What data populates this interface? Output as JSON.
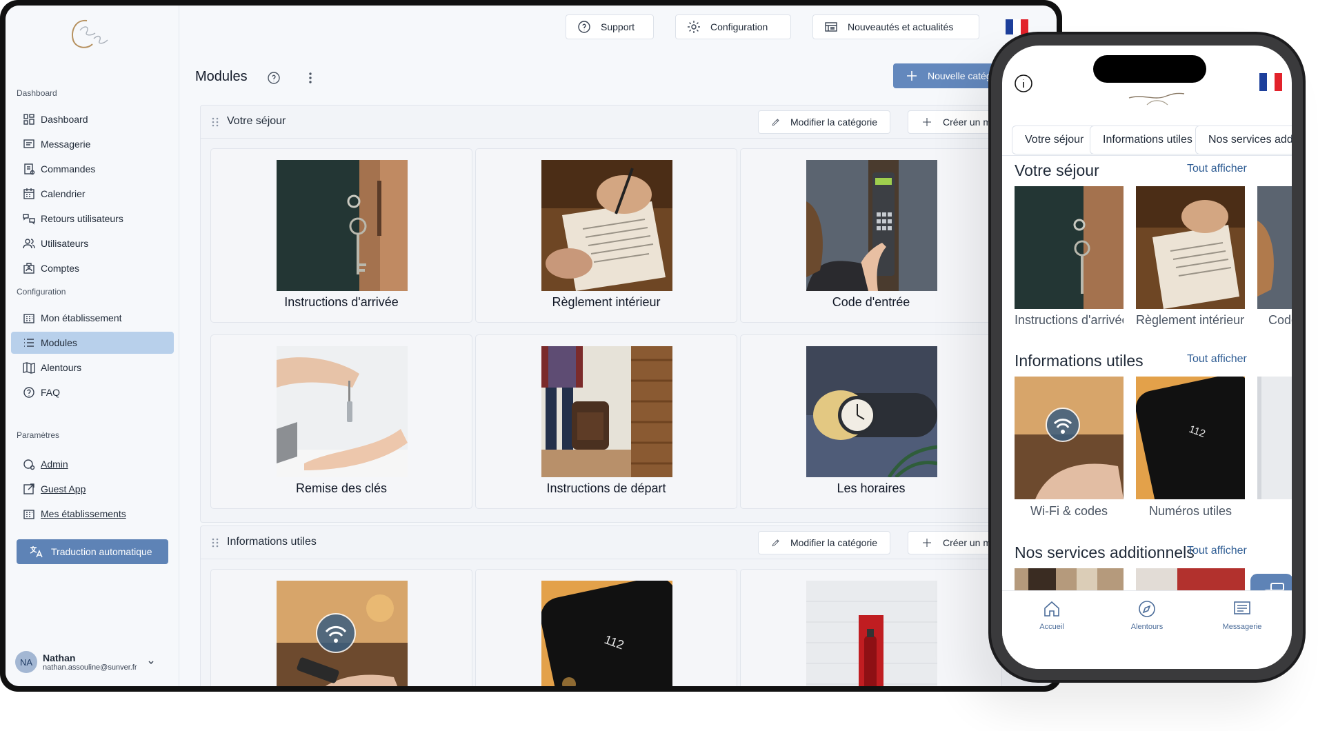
{
  "sidebar": {
    "sections": {
      "dashboard": "Dashboard",
      "configuration": "Configuration",
      "parametres": "Paramètres"
    },
    "items": {
      "dashboard": "Dashboard",
      "messagerie": "Messagerie",
      "commandes": "Commandes",
      "calendrier": "Calendrier",
      "retours": "Retours utilisateurs",
      "utilisateurs": "Utilisateurs",
      "comptes": "Comptes",
      "etablissement": "Mon établissement",
      "modules": "Modules",
      "alentours": "Alentours",
      "faq": "FAQ",
      "admin": "Admin",
      "guest_app": "Guest App",
      "mes_etablissements": "Mes établissements"
    },
    "translate_button": "Traduction automatique",
    "user": {
      "initials": "NA",
      "name": "Nathan",
      "email": "nathan.assouline@sunver.fr"
    }
  },
  "topbar": {
    "support": "Support",
    "configuration": "Configuration",
    "news": "Nouveautés et actualités"
  },
  "page": {
    "title": "Modules",
    "new_category_button": "Nouvelle catégorie"
  },
  "categories": [
    {
      "name": "Votre séjour",
      "edit_label": "Modifier la catégorie",
      "create_label": "Créer un module",
      "modules": [
        "Instructions d'arrivée",
        "Règlement intérieur",
        "Code d'entrée",
        "Remise des clés",
        "Instructions de départ",
        "Les horaires"
      ]
    },
    {
      "name": "Informations utiles",
      "edit_label": "Modifier la catégorie",
      "create_label": "Créer un module"
    }
  ],
  "phone": {
    "chips": [
      "Votre séjour",
      "Informations utiles",
      "Nos services additionnels"
    ],
    "sections": [
      {
        "title": "Votre séjour",
        "see_all": "Tout afficher",
        "tiles": [
          "Instructions d'arrivée",
          "Règlement intérieur",
          "Code d'entrée"
        ]
      },
      {
        "title": "Informations utiles",
        "see_all": "Tout afficher",
        "tiles": [
          "Wi-Fi & codes",
          "Numéros utiles"
        ]
      },
      {
        "title": "Nos services additionnels",
        "see_all": "Tout afficher"
      }
    ],
    "tabs": [
      "Accueil",
      "Alentours",
      "Messagerie"
    ]
  },
  "colors": {
    "accent": "#6388bd",
    "active_nav": "#b8d0eb",
    "link": "#2f5d94",
    "flag_blue": "#1d3f9b",
    "flag_red": "#e2222b"
  }
}
